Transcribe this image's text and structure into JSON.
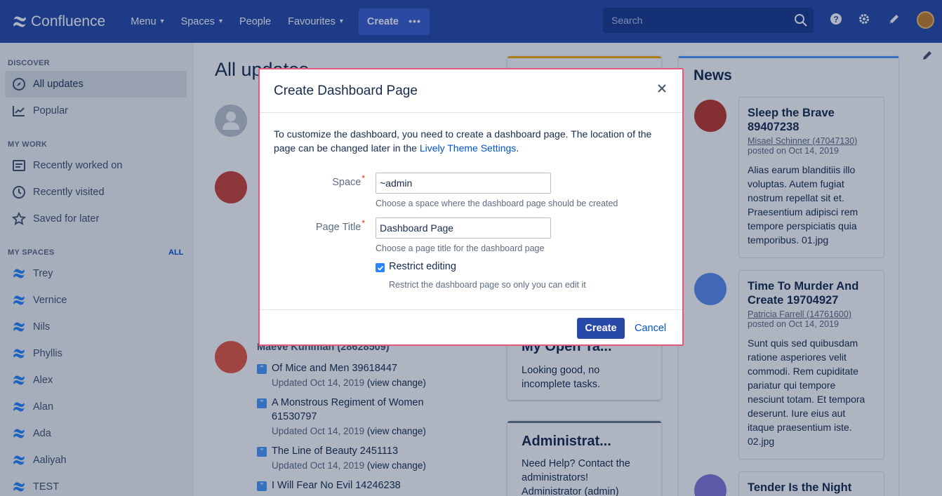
{
  "topnav": {
    "brand": "Confluence",
    "menu": "Menu",
    "spaces": "Spaces",
    "people": "People",
    "favourites": "Favourites",
    "create": "Create",
    "search_placeholder": "Search"
  },
  "sidebar": {
    "discover_title": "DISCOVER",
    "all_updates": "All updates",
    "popular": "Popular",
    "mywork_title": "MY WORK",
    "recently_worked": "Recently worked on",
    "recently_visited": "Recently visited",
    "saved_for_later": "Saved for later",
    "myspaces_title": "MY SPACES",
    "all_link": "ALL",
    "spaces": [
      "Trey",
      "Vernice",
      "Nils",
      "Phyllis",
      "Alex",
      "Alan",
      "Ada",
      "Aaliyah",
      "TEST"
    ]
  },
  "main": {
    "title": "All updates",
    "author": "Maeve Kuhlman (28628509)",
    "updates": [
      {
        "title": "Of Mice and Men 39618447",
        "meta": "Updated Oct 14, 2019",
        "link": "(view change)"
      },
      {
        "title1": "A Monstrous Regiment of Women",
        "title2": "61530797",
        "meta": "Updated Oct 14, 2019",
        "link": "(view change)"
      },
      {
        "title": "The Line of Beauty 2451113",
        "meta": "Updated Oct 14, 2019",
        "link": "(view change)"
      },
      {
        "title": "I Will Fear No Evil 14246238"
      }
    ]
  },
  "middle": {
    "tasks_title": "My Open Ta...",
    "tasks_body1": "Looking good, no",
    "tasks_body2": "incomplete tasks.",
    "admin_title": "Administrat...",
    "admin_body1": "Need Help? Contact the",
    "admin_body2": "administrators!",
    "admin_body3": "Administrator (admin)"
  },
  "news": {
    "title": "News",
    "items": [
      {
        "title1": "Sleep the Brave",
        "title2": "89407238",
        "author": "Misael Schinner (47047130)",
        "posted": "posted on Oct 14, 2019",
        "body": [
          "Alias earum blanditiis illo",
          "voluptas. Autem fugiat",
          "nostrum repellat sit et.",
          "Praesentium adipisci rem",
          "tempore perspiciatis quia",
          "temporibus. 01.jpg"
        ]
      },
      {
        "title1": "Time To Murder And",
        "title2": "Create 19704927",
        "author": "Patricia Farrell (14761600)",
        "posted": "posted on Oct 14, 2019",
        "body": [
          "Sunt quis sed quibusdam",
          "ratione asperiores velit",
          "commodi. Rem cupiditate",
          "pariatur qui tempore",
          "nesciunt totam. Et tempora",
          "deserunt. Iure eius aut",
          "itaque praesentium iste.",
          "02.jpg"
        ]
      },
      {
        "title1": "Tender Is the Night"
      }
    ]
  },
  "dialog": {
    "title": "Create Dashboard Page",
    "desc_text": "To customize the dashboard, you need to create a dashboard page. The location of the page can be changed later in the ",
    "desc_link": "Lively Theme Settings",
    "desc_end": ".",
    "space_label": "Space",
    "space_value": "~admin",
    "space_help": "Choose a space where the dashboard page should be created",
    "title_label": "Page Title",
    "title_value": "Dashboard Page",
    "title_help": "Choose a page title for the dashboard page",
    "restrict_label": "Restrict editing",
    "restrict_help": "Restrict the dashboard page so only you can edit it",
    "create_btn": "Create",
    "cancel_btn": "Cancel"
  },
  "colors": {
    "nav": "#2849a8",
    "accent": "#0052cc",
    "dialog_border": "#e3587d"
  }
}
